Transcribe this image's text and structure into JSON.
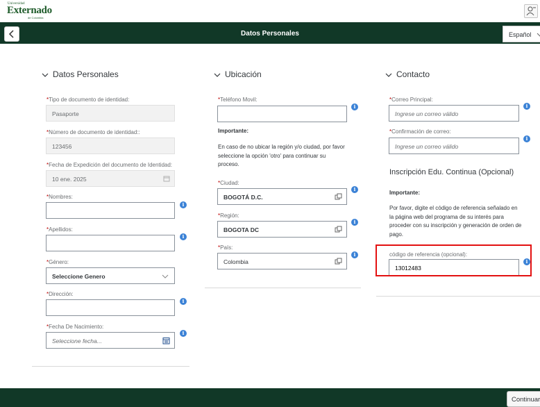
{
  "brand": {
    "small": "Universidad",
    "name": "Externado",
    "sub": "de Colombia"
  },
  "header": {
    "title": "Datos Personales",
    "language": "Español"
  },
  "personal": {
    "title": "Datos Personales",
    "doc_type_label": "Tipo de documento de identidad:",
    "doc_type_value": "Pasaporte",
    "doc_number_label": "Número de documento de identidad::",
    "doc_number_value": "123456",
    "issue_date_label": "Fecha de Expedición del documento de Identidad:",
    "issue_date_value": "10 ene. 2025",
    "names_label": "Nombres:",
    "names_value": "",
    "surnames_label": "Apellidos:",
    "surnames_value": "",
    "gender_label": "Género:",
    "gender_value": "Seleccione Genero",
    "address_label": "Dirección:",
    "address_value": "",
    "birth_label": "Fecha De Nacimiento:",
    "birth_placeholder": "Seleccione fecha..."
  },
  "location": {
    "title": "Ubicación",
    "phone_label": "Teléfono Movil:",
    "phone_value": "",
    "important_title": "Importante:",
    "important_text": "En caso de no ubicar la región y/o ciudad, por favor seleccione la opción 'otro' para continuar su proceso.",
    "city_label": "Ciudad:",
    "city_value": "BOGOTÁ D.C.",
    "region_label": "Región:",
    "region_value": "BOGOTA DC",
    "country_label": "País:",
    "country_value": "Colombia"
  },
  "contact": {
    "title": "Contacto",
    "email_label": "Correo Principal:",
    "email_placeholder": "Ingrese un correo válido",
    "email_confirm_label": "Confirmación de correo:",
    "email_confirm_placeholder": "Ingrese un correo válido",
    "continuing_title": "Inscripción Edu. Continua (Opcional)",
    "important_title": "Importante:",
    "important_text": "Por favor, digite el código de referencia señalado en la página web del programa de su interés para proceder con su inscripción y generación de orden de pago.",
    "ref_label": "código de referencia (opcional):",
    "ref_value": "13012483"
  },
  "required_mark": "*",
  "info_glyph": "i",
  "footer": {
    "continue_label": "Continuar"
  },
  "colors": {
    "header_bg": "#113827",
    "accent": "#3b82d6",
    "required": "#bb0000",
    "highlight": "#e31010"
  }
}
